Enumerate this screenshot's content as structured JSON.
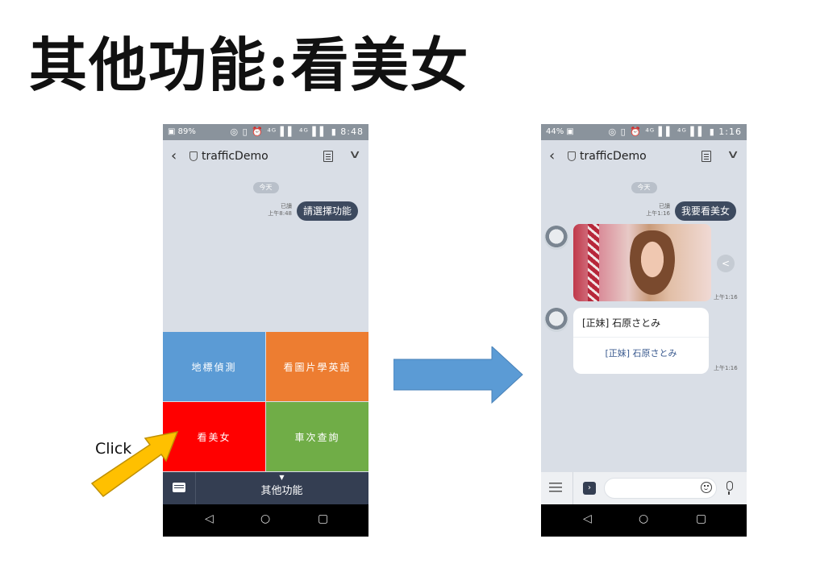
{
  "slide": {
    "title": "其他功能:看美女"
  },
  "phone_left": {
    "status": {
      "left": "▣ 89%",
      "right": "◎ ▯ ⏰ ⁴ᴳ ▌▌ ⁴ᴳ ▌▌ ▮ 8:48"
    },
    "chat_title": "trafficDemo",
    "date": "今天",
    "read_label": "已讀",
    "time": "上午8:48",
    "message": "請選擇功能",
    "rich_menu": [
      {
        "label": "地標偵測",
        "color": "#5b9bd5"
      },
      {
        "label": "看圖片學英語",
        "color": "#ed7d31"
      },
      {
        "label": "看美女",
        "color": "#ff0000"
      },
      {
        "label": "車次查詢",
        "color": "#70ad47"
      }
    ],
    "menu_label": "其他功能",
    "nav": {
      "back": "◁",
      "home": "○",
      "recent": "▢"
    }
  },
  "phone_right": {
    "status": {
      "left": "44% ▣",
      "right": "◎ ▯ ⏰ ⁴ᴳ ▌▌ ⁴ᴳ ▌▌ ▮ 1:16"
    },
    "chat_title": "trafficDemo",
    "date": "今天",
    "read_label": "已讀",
    "time": "上午1:16",
    "message": "我要看美女",
    "image_time": "上午1:16",
    "card": {
      "title": "[正妹] 石原さとみ",
      "button": "[正妹] 石原さとみ",
      "time": "上午1:16"
    },
    "nav": {
      "back": "◁",
      "home": "○",
      "recent": "▢"
    }
  },
  "annotation": {
    "click_label": "Click"
  }
}
